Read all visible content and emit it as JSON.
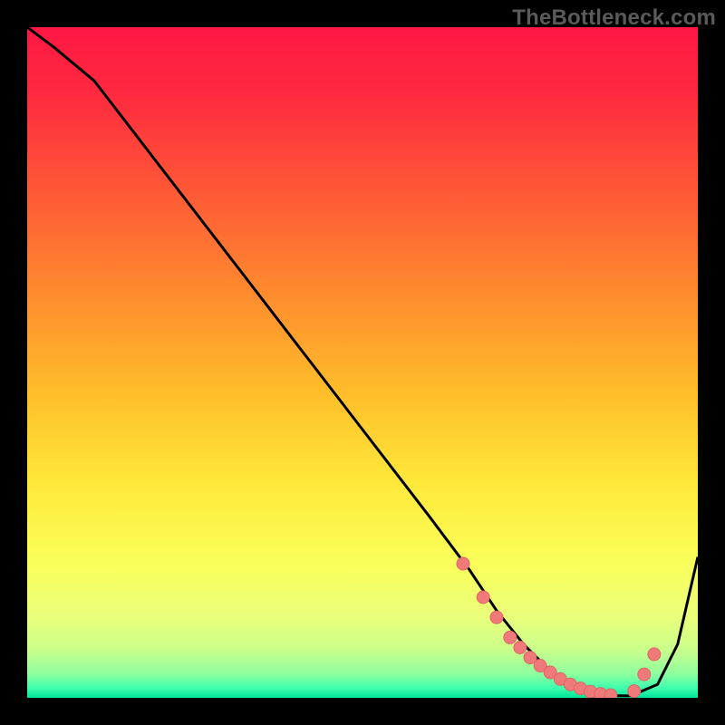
{
  "watermark": "TheBottleneck.com",
  "colors": {
    "gradient_stops": [
      {
        "offset": 0.0,
        "color": "#ff1744"
      },
      {
        "offset": 0.1,
        "color": "#ff2a3f"
      },
      {
        "offset": 0.25,
        "color": "#ff5a36"
      },
      {
        "offset": 0.4,
        "color": "#ff8c2e"
      },
      {
        "offset": 0.55,
        "color": "#ffbf2a"
      },
      {
        "offset": 0.68,
        "color": "#ffe93a"
      },
      {
        "offset": 0.8,
        "color": "#faff5a"
      },
      {
        "offset": 0.88,
        "color": "#e9ff7a"
      },
      {
        "offset": 0.93,
        "color": "#c8ff8c"
      },
      {
        "offset": 0.965,
        "color": "#8cff9e"
      },
      {
        "offset": 0.985,
        "color": "#3fffad"
      },
      {
        "offset": 1.0,
        "color": "#00e59a"
      }
    ],
    "curve": "#000000",
    "marker_fill": "#f07a7a",
    "marker_stroke": "#e06565",
    "background": "#000000"
  },
  "chart_data": {
    "type": "line",
    "title": "",
    "xlabel": "",
    "ylabel": "",
    "xlim": [
      0,
      100
    ],
    "ylim": [
      0,
      100
    ],
    "grid": false,
    "legend": false,
    "series": [
      {
        "name": "bottleneck-curve",
        "x": [
          0,
          4,
          10,
          20,
          30,
          40,
          50,
          60,
          66,
          70,
          74,
          78,
          82,
          86,
          90,
          94,
          97,
          100
        ],
        "y": [
          100,
          97,
          92,
          79,
          66,
          53,
          40,
          27,
          19,
          13,
          8,
          4,
          1.2,
          0.3,
          0.3,
          2,
          8,
          21
        ]
      }
    ],
    "markers": {
      "name": "highlight-dots",
      "x": [
        65,
        68,
        70,
        72,
        73.5,
        75,
        76.5,
        78,
        79.5,
        81,
        82.5,
        84,
        85.5,
        87,
        90.5,
        92,
        93.5
      ],
      "y": [
        20,
        15,
        12,
        9,
        7.5,
        6,
        4.8,
        3.8,
        2.8,
        2,
        1.4,
        0.9,
        0.6,
        0.4,
        1.0,
        3.5,
        6.5
      ],
      "r": 7
    }
  }
}
